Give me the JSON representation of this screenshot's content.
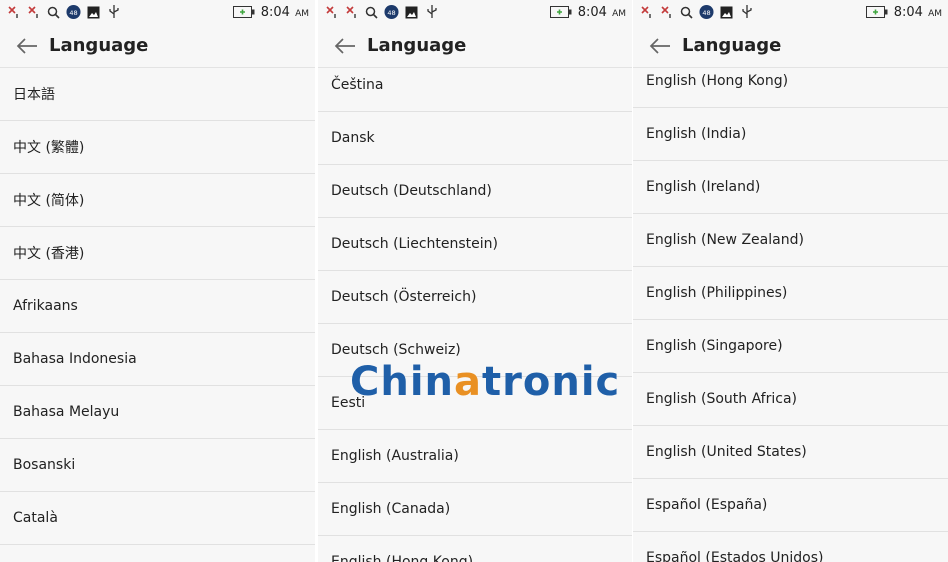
{
  "status_bar": {
    "time": "8:04",
    "ampm": "AM",
    "notification_badge": "48"
  },
  "screens": [
    {
      "title": "Language",
      "items": [
        "日本語",
        "中文 (繁體)",
        "中文 (简体)",
        "中文 (香港)",
        "Afrikaans",
        "Bahasa Indonesia",
        "Bahasa Melayu",
        "Bosanski",
        "Català"
      ]
    },
    {
      "title": "Language",
      "items": [
        "Čeština",
        "Dansk",
        "Deutsch (Deutschland)",
        "Deutsch (Liechtenstein)",
        "Deutsch (Österreich)",
        "Deutsch (Schweiz)",
        "Eesti",
        "English (Australia)",
        "English (Canada)",
        "English (Hong Kong)"
      ]
    },
    {
      "title": "Language",
      "items": [
        "English (Hong Kong)",
        "English (India)",
        "English (Ireland)",
        "English (New Zealand)",
        "English (Philippines)",
        "English (Singapore)",
        "English (South Africa)",
        "English (United States)",
        "Español (España)",
        "Español (Estados Unidos)"
      ]
    }
  ],
  "watermark": {
    "part1": "Chin",
    "part2": "a",
    "part3": "tronic"
  },
  "colors": {
    "background": "#f7f7f7",
    "divider": "#e1e1e1",
    "watermark_blue": "#1f5fa8",
    "watermark_orange": "#e99023"
  }
}
